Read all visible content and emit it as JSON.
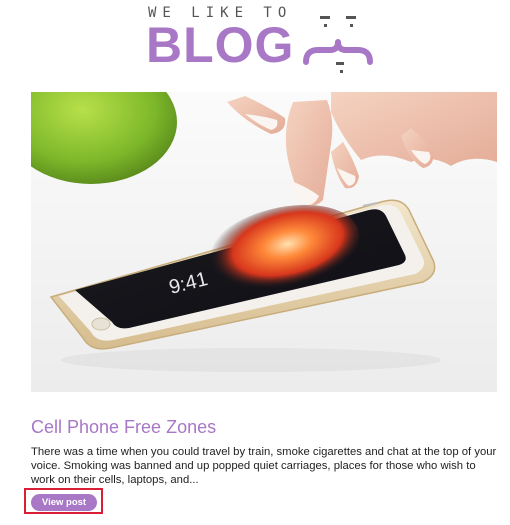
{
  "header": {
    "tagline": "WE LIKE TO",
    "wordmark": "BLOG",
    "logo_icon": "winking-face-icon",
    "brand_color": "#a877c6"
  },
  "hero": {
    "image_icon": "smartphone-photo",
    "phone_time": "9:41"
  },
  "post": {
    "title": "Cell Phone Free Zones",
    "excerpt": "There was a time when you could travel by train, smoke cigarettes and chat at the top of your voice. Smoking was banned and up popped quiet carriages, places for those who wish to work on their cells, laptops, and...",
    "button_label": "View post",
    "highlight_color": "#d81f36"
  }
}
